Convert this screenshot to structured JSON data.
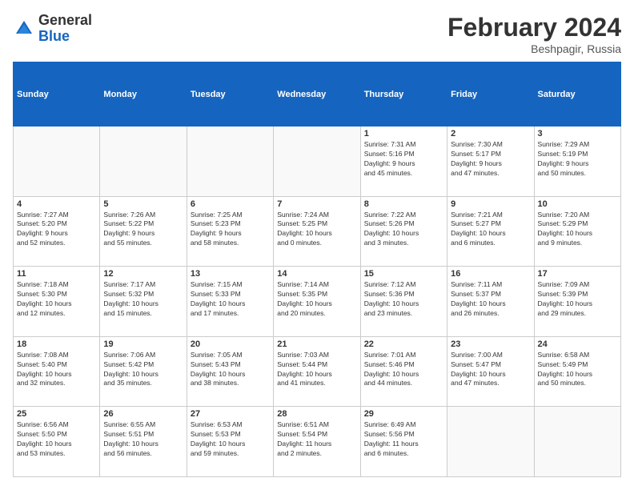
{
  "logo": {
    "general": "General",
    "blue": "Blue"
  },
  "title": {
    "month": "February 2024",
    "location": "Beshpagir, Russia"
  },
  "days_of_week": [
    "Sunday",
    "Monday",
    "Tuesday",
    "Wednesday",
    "Thursday",
    "Friday",
    "Saturday"
  ],
  "weeks": [
    [
      {
        "day": "",
        "info": ""
      },
      {
        "day": "",
        "info": ""
      },
      {
        "day": "",
        "info": ""
      },
      {
        "day": "",
        "info": ""
      },
      {
        "day": "1",
        "info": "Sunrise: 7:31 AM\nSunset: 5:16 PM\nDaylight: 9 hours\nand 45 minutes."
      },
      {
        "day": "2",
        "info": "Sunrise: 7:30 AM\nSunset: 5:17 PM\nDaylight: 9 hours\nand 47 minutes."
      },
      {
        "day": "3",
        "info": "Sunrise: 7:29 AM\nSunset: 5:19 PM\nDaylight: 9 hours\nand 50 minutes."
      }
    ],
    [
      {
        "day": "4",
        "info": "Sunrise: 7:27 AM\nSunset: 5:20 PM\nDaylight: 9 hours\nand 52 minutes."
      },
      {
        "day": "5",
        "info": "Sunrise: 7:26 AM\nSunset: 5:22 PM\nDaylight: 9 hours\nand 55 minutes."
      },
      {
        "day": "6",
        "info": "Sunrise: 7:25 AM\nSunset: 5:23 PM\nDaylight: 9 hours\nand 58 minutes."
      },
      {
        "day": "7",
        "info": "Sunrise: 7:24 AM\nSunset: 5:25 PM\nDaylight: 10 hours\nand 0 minutes."
      },
      {
        "day": "8",
        "info": "Sunrise: 7:22 AM\nSunset: 5:26 PM\nDaylight: 10 hours\nand 3 minutes."
      },
      {
        "day": "9",
        "info": "Sunrise: 7:21 AM\nSunset: 5:27 PM\nDaylight: 10 hours\nand 6 minutes."
      },
      {
        "day": "10",
        "info": "Sunrise: 7:20 AM\nSunset: 5:29 PM\nDaylight: 10 hours\nand 9 minutes."
      }
    ],
    [
      {
        "day": "11",
        "info": "Sunrise: 7:18 AM\nSunset: 5:30 PM\nDaylight: 10 hours\nand 12 minutes."
      },
      {
        "day": "12",
        "info": "Sunrise: 7:17 AM\nSunset: 5:32 PM\nDaylight: 10 hours\nand 15 minutes."
      },
      {
        "day": "13",
        "info": "Sunrise: 7:15 AM\nSunset: 5:33 PM\nDaylight: 10 hours\nand 17 minutes."
      },
      {
        "day": "14",
        "info": "Sunrise: 7:14 AM\nSunset: 5:35 PM\nDaylight: 10 hours\nand 20 minutes."
      },
      {
        "day": "15",
        "info": "Sunrise: 7:12 AM\nSunset: 5:36 PM\nDaylight: 10 hours\nand 23 minutes."
      },
      {
        "day": "16",
        "info": "Sunrise: 7:11 AM\nSunset: 5:37 PM\nDaylight: 10 hours\nand 26 minutes."
      },
      {
        "day": "17",
        "info": "Sunrise: 7:09 AM\nSunset: 5:39 PM\nDaylight: 10 hours\nand 29 minutes."
      }
    ],
    [
      {
        "day": "18",
        "info": "Sunrise: 7:08 AM\nSunset: 5:40 PM\nDaylight: 10 hours\nand 32 minutes."
      },
      {
        "day": "19",
        "info": "Sunrise: 7:06 AM\nSunset: 5:42 PM\nDaylight: 10 hours\nand 35 minutes."
      },
      {
        "day": "20",
        "info": "Sunrise: 7:05 AM\nSunset: 5:43 PM\nDaylight: 10 hours\nand 38 minutes."
      },
      {
        "day": "21",
        "info": "Sunrise: 7:03 AM\nSunset: 5:44 PM\nDaylight: 10 hours\nand 41 minutes."
      },
      {
        "day": "22",
        "info": "Sunrise: 7:01 AM\nSunset: 5:46 PM\nDaylight: 10 hours\nand 44 minutes."
      },
      {
        "day": "23",
        "info": "Sunrise: 7:00 AM\nSunset: 5:47 PM\nDaylight: 10 hours\nand 47 minutes."
      },
      {
        "day": "24",
        "info": "Sunrise: 6:58 AM\nSunset: 5:49 PM\nDaylight: 10 hours\nand 50 minutes."
      }
    ],
    [
      {
        "day": "25",
        "info": "Sunrise: 6:56 AM\nSunset: 5:50 PM\nDaylight: 10 hours\nand 53 minutes."
      },
      {
        "day": "26",
        "info": "Sunrise: 6:55 AM\nSunset: 5:51 PM\nDaylight: 10 hours\nand 56 minutes."
      },
      {
        "day": "27",
        "info": "Sunrise: 6:53 AM\nSunset: 5:53 PM\nDaylight: 10 hours\nand 59 minutes."
      },
      {
        "day": "28",
        "info": "Sunrise: 6:51 AM\nSunset: 5:54 PM\nDaylight: 11 hours\nand 2 minutes."
      },
      {
        "day": "29",
        "info": "Sunrise: 6:49 AM\nSunset: 5:56 PM\nDaylight: 11 hours\nand 6 minutes."
      },
      {
        "day": "",
        "info": ""
      },
      {
        "day": "",
        "info": ""
      }
    ]
  ]
}
